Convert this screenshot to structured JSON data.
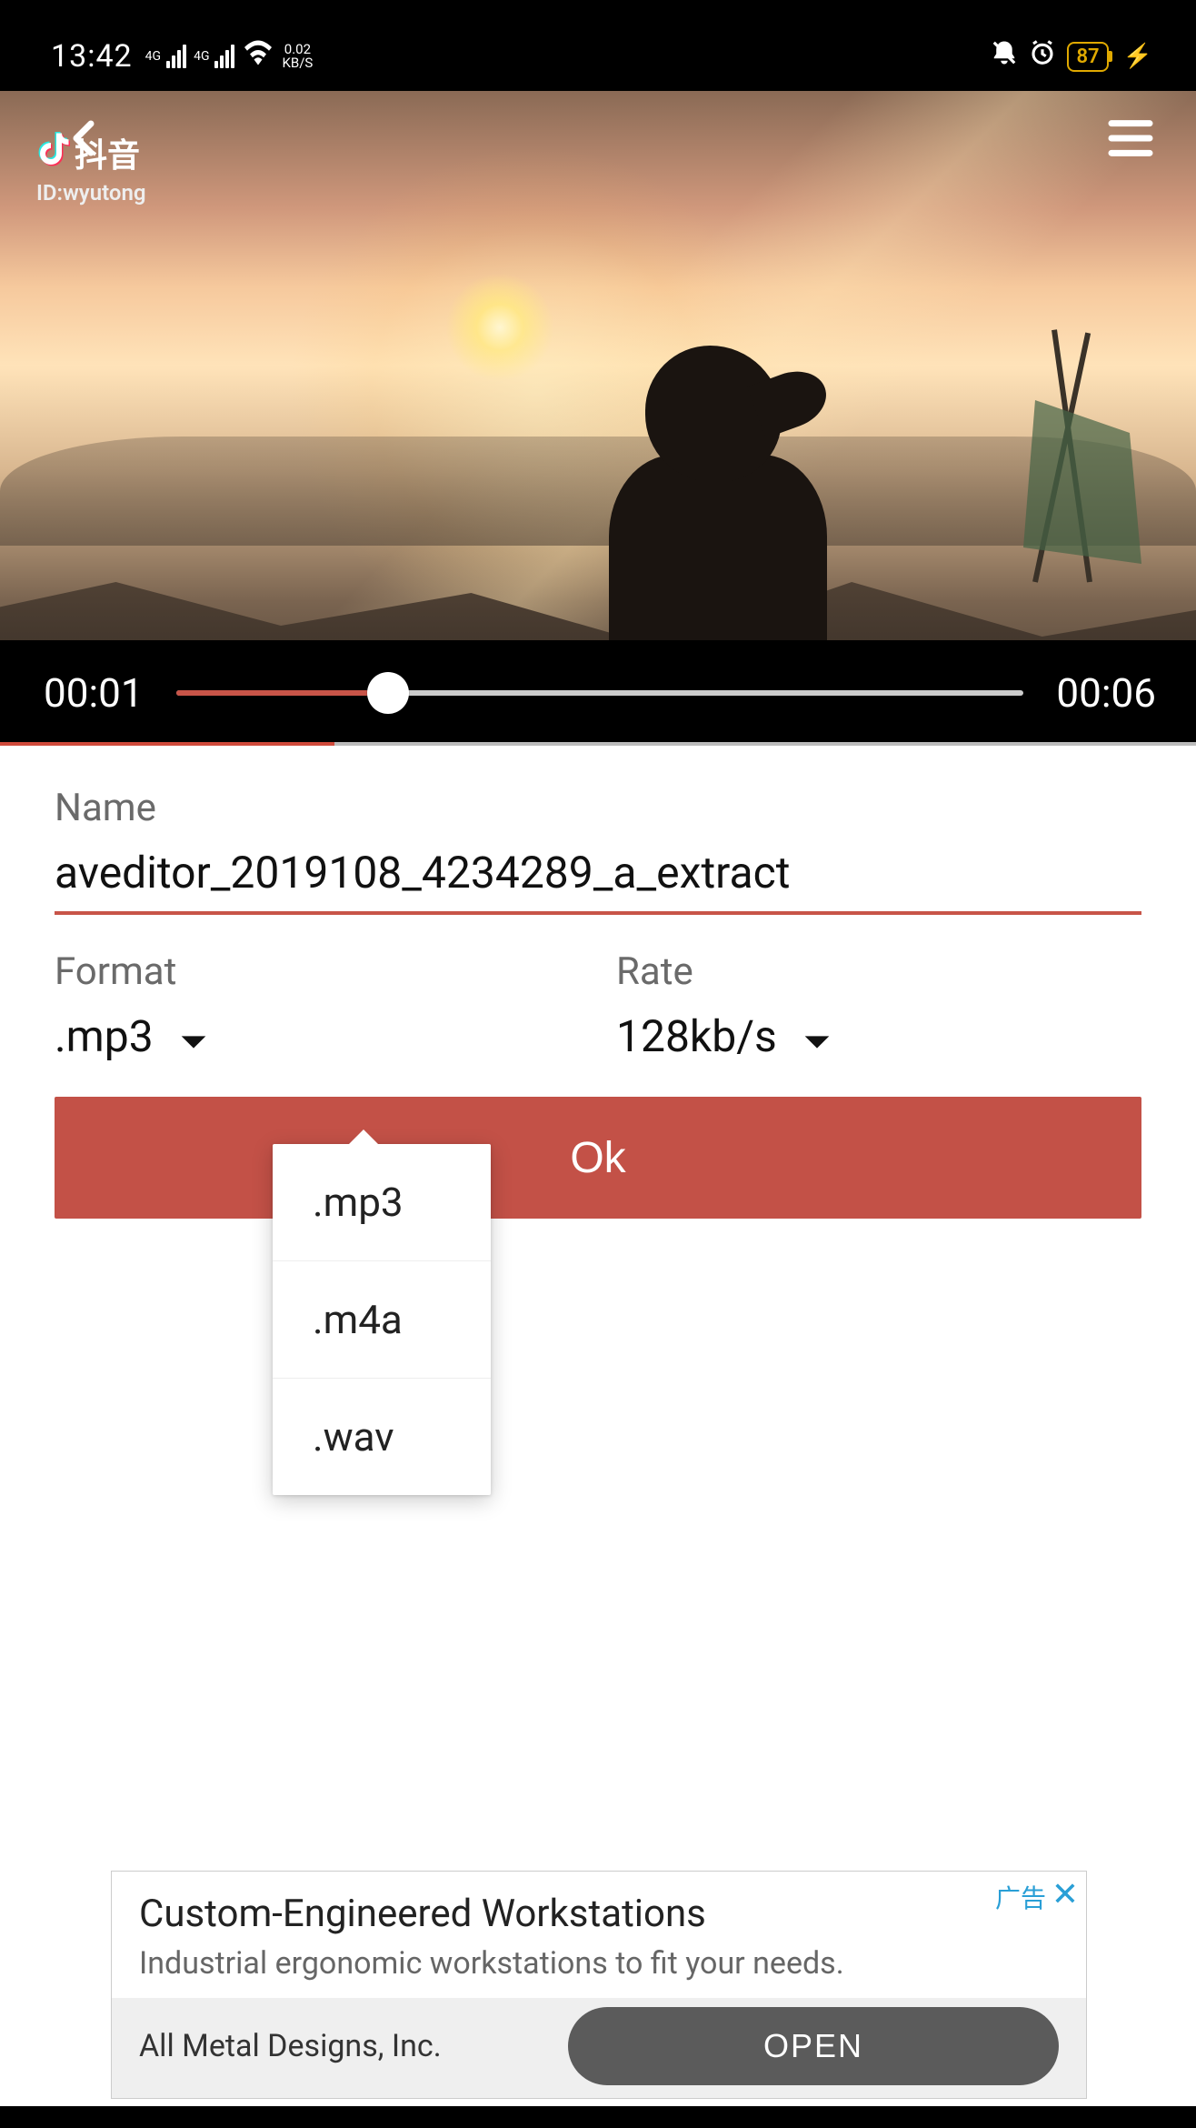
{
  "status_bar": {
    "time": "13:42",
    "network_label_1": "4G",
    "network_label_2": "4G",
    "speed_top": "0.02",
    "speed_bottom": "KB/S",
    "battery_level": "87"
  },
  "video_overlay": {
    "app_name": "抖音",
    "user_id": "ID:wyutong"
  },
  "player": {
    "time_elapsed": "00:01",
    "time_total": "00:06"
  },
  "form": {
    "name_label": "Name",
    "name_value": "aveditor_2019108_4234289_a_extract",
    "format_label": "Format",
    "format_value": ".mp3",
    "rate_label": "Rate",
    "rate_value": "128kb/s",
    "ok_label": "Ok"
  },
  "format_options": {
    "opt1": ".mp3",
    "opt2": ".m4a",
    "opt3": ".wav"
  },
  "ad": {
    "badge": "广告",
    "title": "Custom-Engineered Workstations",
    "subtitle": "Industrial ergonomic workstations to fit your needs.",
    "company": "All Metal Designs, Inc.",
    "open_label": "OPEN"
  }
}
